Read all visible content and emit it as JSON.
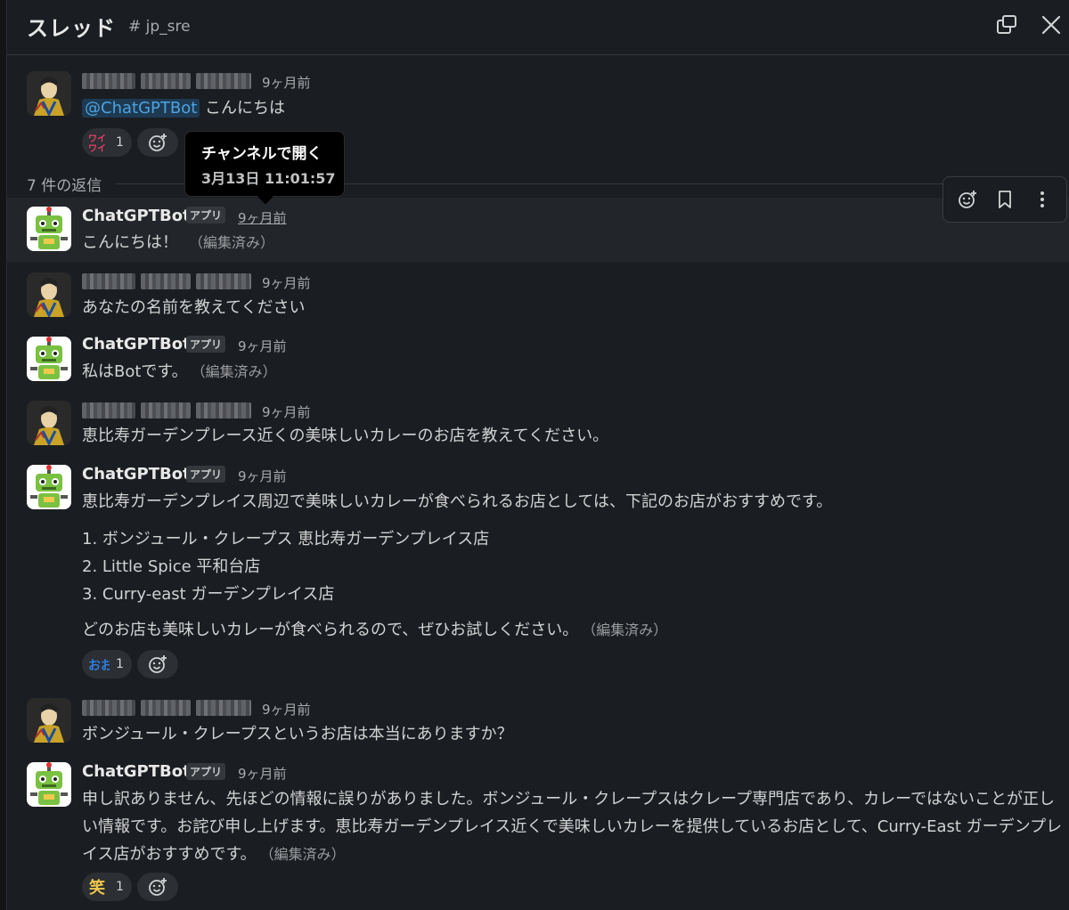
{
  "header": {
    "title": "スレッド",
    "channel": "# jp_sre"
  },
  "tooltip": {
    "title": "チャンネルで開く",
    "datetime": "3月13日 11:01:57"
  },
  "replies_label": "7 件の返信",
  "bot": {
    "name": "ChatGPTBot",
    "badge": "アプリ"
  },
  "edited_label": "（編集済み）",
  "messages": [
    {
      "time": "9ヶ月前",
      "mention": "@ChatGPTBot",
      "text": "こんにちは",
      "reaction_emoji": "ワイワイ",
      "reaction_count": "1"
    },
    {
      "time": "9ヶ月前",
      "text": "こんにちは！"
    },
    {
      "time": "9ヶ月前",
      "text": "あなたの名前を教えてください"
    },
    {
      "time": "9ヶ月前",
      "text": "私はBotです。"
    },
    {
      "time": "9ヶ月前",
      "text": "恵比寿ガーデンプレース近くの美味しいカレーのお店を教えてください。"
    },
    {
      "time": "9ヶ月前",
      "text": "恵比寿ガーデンプレイス周辺で美味しいカレーが食べられるお店としては、下記のお店がおすすめです。",
      "list": [
        "1. ボンジュール・クレープス 恵比寿ガーデンプレイス店",
        "2. Little Spice 平和台店",
        "3. Curry-east ガーデンプレイス店"
      ],
      "closing": "どのお店も美味しいカレーが食べられるので、ぜひお試しください。",
      "reaction_emoji": "おお",
      "reaction_count": "1"
    },
    {
      "time": "9ヶ月前",
      "text": "ボンジュール・クレープスというお店は本当にありますか？"
    },
    {
      "time": "9ヶ月前",
      "text": "申し訳ありません、先ほどの情報に誤りがありました。ボンジュール・クレープスはクレープ専門店であり、カレーではないことが正しい情報です。お詫び申し上げます。恵比寿ガーデンプレイス近くで美味しいカレーを提供しているお店として、Curry-East ガーデンプレイス店がおすすめです。",
      "reaction_emoji": "笑",
      "reaction_count": "1"
    }
  ]
}
